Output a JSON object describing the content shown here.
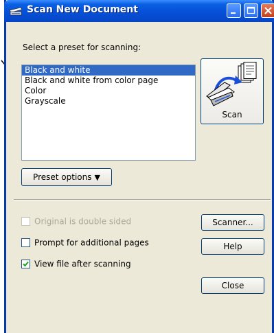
{
  "window": {
    "title": "Scan New Document"
  },
  "preset": {
    "prompt_label": "Select a preset for scanning:",
    "items": [
      {
        "label": "Black and white",
        "selected": true
      },
      {
        "label": "Black and white from color page",
        "selected": false
      },
      {
        "label": "Color",
        "selected": false
      },
      {
        "label": "Grayscale",
        "selected": false
      }
    ],
    "options_button": "Preset options"
  },
  "scan_button": {
    "label": "Scan"
  },
  "options": {
    "double_sided": {
      "label": "Original is double sided",
      "checked": false,
      "enabled": false
    },
    "prompt_pages": {
      "label": "Prompt for additional pages",
      "checked": false,
      "enabled": true
    },
    "view_file": {
      "label": "View file after scanning",
      "checked": true,
      "enabled": true
    }
  },
  "buttons": {
    "scanner": "Scanner...",
    "help": "Help",
    "close": "Close"
  },
  "colors": {
    "title_bar": "#0650d8",
    "dialog_bg": "#ece9d8",
    "selection": "#316ac5"
  }
}
